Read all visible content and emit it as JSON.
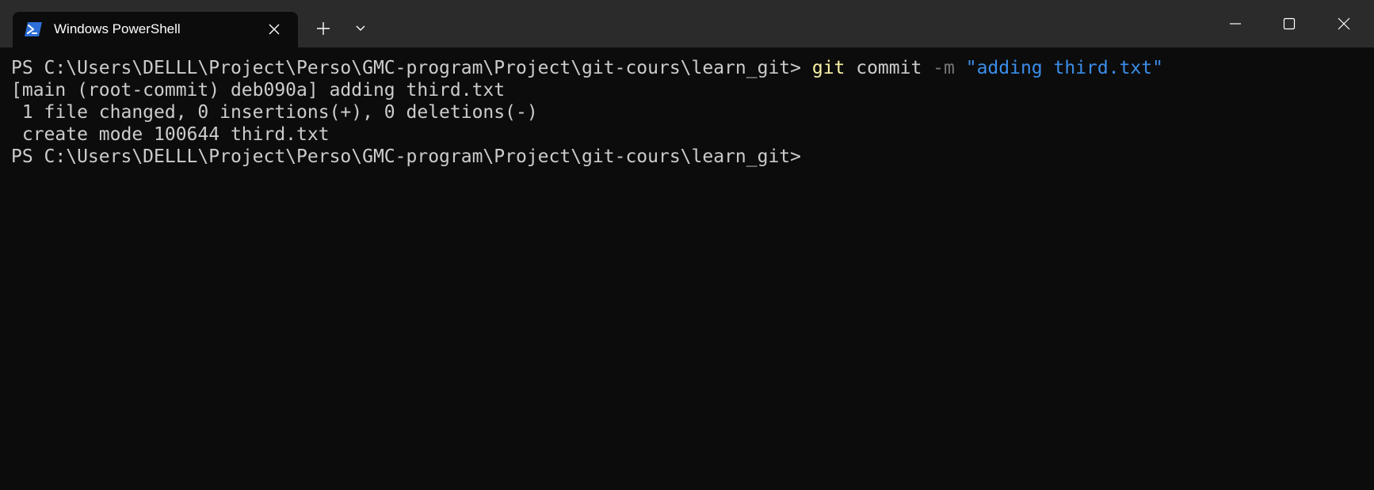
{
  "window": {
    "tab_title": "Windows PowerShell",
    "colors": {
      "background": "#0c0c0c",
      "titlebar": "#2b2b2b",
      "text": "#cccccc",
      "command": "#f9f1a5",
      "parameter": "#767676",
      "string": "#3b8eea"
    },
    "icons": {
      "tab": "powershell-icon",
      "close_tab": "close-icon",
      "new_tab": "plus-icon",
      "dropdown": "chevron-down-icon",
      "minimize": "minimize-icon",
      "maximize": "maximize-icon",
      "close_window": "close-icon"
    }
  },
  "terminal": {
    "lines": [
      {
        "prompt": "PS C:\\Users\\DELLL\\Project\\Perso\\GMC-program\\Project\\git-cours\\learn_git> ",
        "command": "git",
        "args": " commit ",
        "param": "-m",
        "string": " \"adding third.txt\""
      },
      {
        "text": "[main (root-commit) deb090a] adding third.txt"
      },
      {
        "text": " 1 file changed, 0 insertions(+), 0 deletions(-)"
      },
      {
        "text": " create mode 100644 third.txt"
      },
      {
        "text": "PS C:\\Users\\DELLL\\Project\\Perso\\GMC-program\\Project\\git-cours\\learn_git>"
      }
    ]
  }
}
